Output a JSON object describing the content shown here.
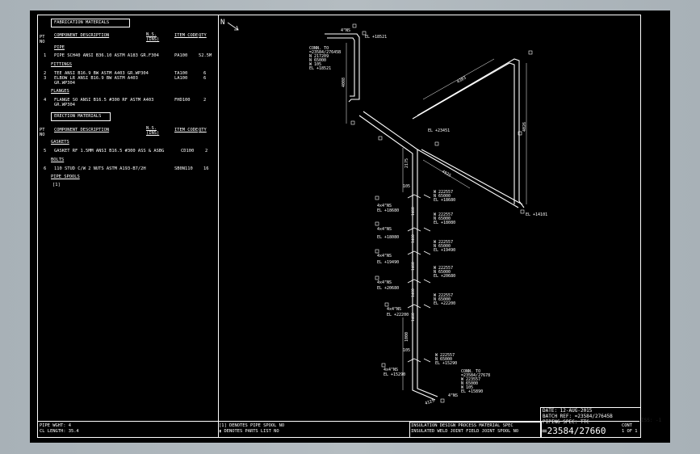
{
  "fabrication": {
    "pt_no": "PT\nNO",
    "header": "FABRICATION MATERIALS",
    "col_desc": "COMPONENT DESCRIPTION",
    "col_ns": "N.S.\n(INS)",
    "col_item": "ITEM CODE",
    "col_qty": "QTY",
    "pipe_label": "PIPE",
    "pipe_row": {
      "pt": "1",
      "desc": "PIPE SCH40 ANSI B36.10 ASTM A183 GR.F304",
      "item": "PA100",
      "qty": "52.5M"
    },
    "fittings_label": "FITTINGS",
    "fitting_rows": [
      {
        "pt": "2",
        "desc": "TEE ANSI B16.9 BW ASTM A403 GR.WP304",
        "item": "TA100",
        "qty": "6"
      },
      {
        "pt": "3",
        "desc": "ELBOW LR ANSI B16.9 BW ASTM A403\nGR.WP304",
        "item": "LA100",
        "qty": "6"
      }
    ],
    "flanges_label": "FLANGES",
    "flange_row": {
      "pt": "4",
      "desc": "FLANGE SO ANSI B16.5 #300 RF ASTM A403\nGR.WP304",
      "item": "FHD100",
      "qty": "2"
    }
  },
  "erection": {
    "pt_no": "PT\nNO",
    "header": "ERECTION MATERIALS",
    "col_desc": "COMPONENT DESCRIPTION",
    "col_ns": "N.S.\n(INS)",
    "col_item": "ITEM CODE",
    "col_qty": "QTY",
    "gaskets_label": "GASKETS",
    "gasket_row": {
      "pt": "5",
      "desc": "GASKET RF 1.5MM ANSI B16.5 #300 ASS & ASBG",
      "item": "CD100",
      "qty": "2"
    },
    "bolts_label": "BOLTS",
    "bolt_row": {
      "pt": "6",
      "desc": "110 STUD C/W 2 NUTS ASTM A193-B7/2H",
      "item": "SB0N110",
      "qty": "16"
    },
    "spools_label": "PIPE SPOOLS",
    "spool_row": "[1]"
  },
  "footer": {
    "pipe_weight": "PIPE WGHT: 4",
    "cl_length": "CL LENGTH: 35.4",
    "note1": "[1] DENOTES PIPE SPOOL NO",
    "note2": "▮ DENOTES PARTS LIST NO",
    "codes1": "INSULATION DESIGN PROCESS MATERIAL SPEC",
    "codes2": "INSULATED WELD JOINT FIELD JOINT SPOOL NO",
    "date": "DATE: 12-AUG-2015",
    "batch_ref": "BATCH REF: =23584/27645B",
    "piping_spec": "PIPING SPEC: TTC",
    "drawing_no": "=23584/27660",
    "cont": "CONT",
    "sheet": "1 OF 1",
    "iss": "ISS: -1"
  },
  "iso": {
    "north": "N",
    "top_el": "EL +18521",
    "conn_top": "CONN. TO\n=23584/27645B\nN 217209\nN 65000\nW 105\nEL +18521",
    "ns_top": "4\"NS",
    "dim_left": "4008",
    "dim_top": "4303",
    "dim_right": "4026",
    "dim_diag": "4925",
    "el_mid": "EL +23451",
    "el_right": "EL +14101",
    "dim_vert": "2175",
    "dim_bottom_vert": "1000",
    "dim_105": "105",
    "branches": [
      {
        "ns": "4x4\"NS",
        "el": "EL +18680",
        "w": "W 222557",
        "n": "N 65000",
        "elw": "EL +18680",
        "dim": "1460"
      },
      {
        "ns": "4x4\"NS",
        "el": "EL +18080",
        "w": "W 222557",
        "n": "N 65000",
        "elw": "EL +18080",
        "dim": "1460"
      },
      {
        "ns": "4x4\"NS",
        "el": "EL +19490",
        "w": "W 222557",
        "n": "N 65000",
        "elw": "EL +19490",
        "dim": "1460"
      },
      {
        "ns": "4x4\"NS",
        "el": "EL +20680",
        "w": "W 222557",
        "n": "N 65000",
        "elw": "EL +20680",
        "dim": "1460"
      },
      {
        "ns": "4x4\"NS",
        "el": "EL +22200",
        "w": "W 222557",
        "n": "N 65000",
        "elw": "EL +22200",
        "dim": "1460"
      },
      {
        "ns": "4x4\"NS",
        "el": "EL +15290",
        "w": "W 222557",
        "n": "N 65000",
        "elw": "EL +15290",
        "dim": ""
      }
    ],
    "conn_bottom": "CONN. TO\n=23584/27678\nW 223557\nN 65000\nW 105\nEL +15890",
    "ns_bottom": "4\"NS",
    "dim_bottom": "4125"
  }
}
